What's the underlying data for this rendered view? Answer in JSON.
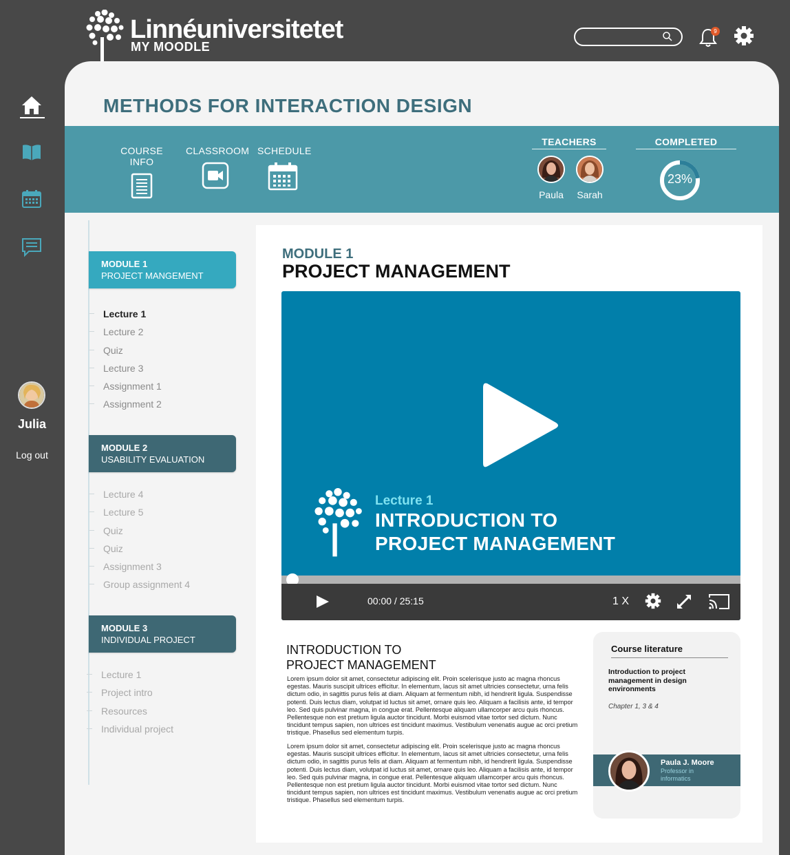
{
  "header": {
    "brand": "Linnéuniversitetet",
    "sub_brand": "MY MOODLE",
    "search": {
      "placeholder": ""
    },
    "notifications": {
      "count": "9"
    }
  },
  "sidebar": {
    "items": [
      {
        "icon": "home-icon"
      },
      {
        "icon": "book-icon"
      },
      {
        "icon": "calendar-icon"
      },
      {
        "icon": "chat-icon"
      }
    ],
    "user_name": "Julia",
    "logout": "Log out"
  },
  "course": {
    "title": "METHODS FOR INTERACTION DESIGN",
    "nav": [
      {
        "label": "COURSE INFO",
        "icon": "document-icon"
      },
      {
        "label": "CLASSROOM",
        "icon": "video-camera-icon"
      },
      {
        "label": "SCHEDULE",
        "icon": "calendar-icon"
      }
    ],
    "teachers_label": "TEACHERS",
    "teachers": [
      {
        "name": "Paula"
      },
      {
        "name": "Sarah"
      }
    ],
    "completed_label": "COMPLETED",
    "completed_text": "23%",
    "completed_fraction": 0.23
  },
  "modules": [
    {
      "number": "MODULE 1",
      "name": "PROJECT MANGEMENT",
      "items": [
        "Lecture 1",
        "Lecture 2",
        "Quiz",
        "Lecture 3",
        "Assignment 1",
        "Assignment 2"
      ]
    },
    {
      "number": "MODULE 2",
      "name": "USABILITY EVALUATION",
      "items": [
        "Lecture 4",
        "Lecture 5",
        "Quiz",
        "Quiz",
        "Assignment 3",
        "Group assignment 4"
      ]
    },
    {
      "number": "MODULE 3",
      "name": "INDIVIDUAL PROJECT",
      "items": [
        "Lecture 1",
        "Project intro",
        "Resources",
        "Individual project"
      ]
    }
  ],
  "content": {
    "module_label": "MODULE 1",
    "module_title": "PROJECT MANAGEMENT",
    "video": {
      "lecture": "Lecture 1",
      "title_line1": "INTRODUCTION TO",
      "title_line2": "PROJECT MANAGEMENT",
      "time": "00:00 / 25:15",
      "speed": "1 X",
      "progress_fraction": 0.0
    },
    "article": {
      "heading_line1": "INTRODUCTION TO",
      "heading_line2": "PROJECT MANAGEMENT",
      "paragraph1": "Lorem ipsum dolor sit amet, consectetur adipiscing elit. Proin scelerisque justo ac magna rhoncus egestas. Mauris suscipit ultrices efficitur. In elementum, lacus sit amet ultricies consectetur, urna felis dictum odio, in sagittis purus felis at diam. Aliquam at fermentum nibh, id hendrerit ligula. Suspendisse potenti. Duis lectus diam, volutpat id luctus sit amet, ornare quis leo. Aliquam a facilisis ante, id tempor leo. Sed quis pulvinar magna, in congue erat. Pellentesque aliquam ullamcorper arcu quis rhoncus. Pellentesque non est pretium ligula auctor tincidunt. Morbi euismod vitae tortor sed dictum. Nunc tincidunt tempus sapien, non ultrices est tincidunt maximus. Vestibulum venenatis augue ac orci pretium tristique. Phasellus sed elementum turpis.",
      "paragraph2": "Lorem ipsum dolor sit amet, consectetur adipiscing elit. Proin scelerisque justo ac magna rhoncus egestas. Mauris suscipit ultrices efficitur. In elementum, lacus sit amet ultricies consectetur, urna felis dictum odio, in sagittis purus felis at diam. Aliquam at fermentum nibh, id hendrerit ligula. Suspendisse potenti. Duis lectus diam, volutpat id luctus sit amet, ornare quis leo. Aliquam a facilisis ante, id tempor leo. Sed quis pulvinar magna, in congue erat. Pellentesque aliquam ullamcorper arcu quis rhoncus. Pellentesque non est pretium ligula auctor tincidunt. Morbi euismod vitae tortor sed dictum. Nunc tincidunt tempus sapien, non ultrices est tincidunt maximus. Vestibulum venenatis augue ac orci pretium tristique. Phasellus sed elementum turpis."
    },
    "literature": {
      "heading": "Course literature",
      "book": "Introduction to project management in design environments",
      "chapters": "Chapter 1, 3 & 4",
      "professor_name": "Paula J. Moore",
      "professor_role": "Professor in informatics"
    }
  },
  "colors": {
    "background": "#484848",
    "teal": "#4c99a8",
    "title_teal": "#3e6e7c",
    "module_active": "#35a9bf",
    "module_inactive": "#3e6874",
    "video_blue": "#017faa",
    "badge": "#e05a2a"
  }
}
